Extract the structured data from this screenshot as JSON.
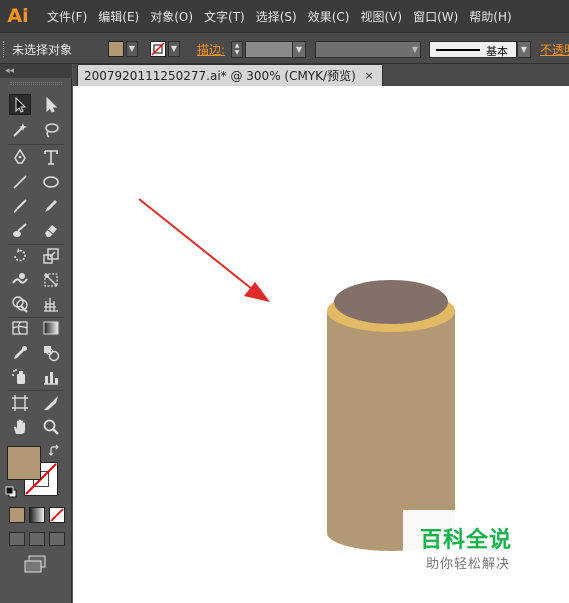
{
  "app": {
    "logo": "Ai"
  },
  "menu": [
    "文件(F)",
    "编辑(E)",
    "对象(O)",
    "文字(T)",
    "选择(S)",
    "效果(C)",
    "视图(V)",
    "窗口(W)",
    "帮助(H)"
  ],
  "control_bar": {
    "selection_status": "未选择对象",
    "stroke_label": "描边:",
    "brush_name": "基本",
    "opacity_label": "不透明"
  },
  "document_tab": {
    "title": "2007920111250277.ai* @ 300% (CMYK/预览)",
    "close": "×"
  },
  "colors": {
    "fill": "#b39973",
    "cylinder_body": "#b39973",
    "cylinder_rim": "#e2b965",
    "cylinder_top": "#837169",
    "arrow": "#e02a28",
    "accent": "#f7931e"
  },
  "toolbox": {
    "tools": [
      "selection-tool-icon",
      "direct-selection-tool-icon",
      "magic-wand-tool-icon",
      "lasso-tool-icon",
      "pen-tool-icon",
      "type-tool-icon",
      "line-segment-tool-icon",
      "ellipse-tool-icon",
      "paintbrush-tool-icon",
      "pencil-tool-icon",
      "blob-brush-tool-icon",
      "eraser-tool-icon",
      "rotate-tool-icon",
      "scale-tool-icon",
      "warp-tool-icon",
      "free-transform-tool-icon",
      "shape-builder-tool-icon",
      "perspective-grid-tool-icon",
      "mesh-tool-icon",
      "gradient-tool-icon",
      "eyedropper-tool-icon",
      "blend-tool-icon",
      "symbol-sprayer-tool-icon",
      "column-graph-tool-icon",
      "artboard-tool-icon",
      "slice-tool-icon",
      "hand-tool-icon",
      "zoom-tool-icon"
    ]
  },
  "watermark": {
    "title": "百科全说",
    "subtitle": "助你轻松解决"
  }
}
